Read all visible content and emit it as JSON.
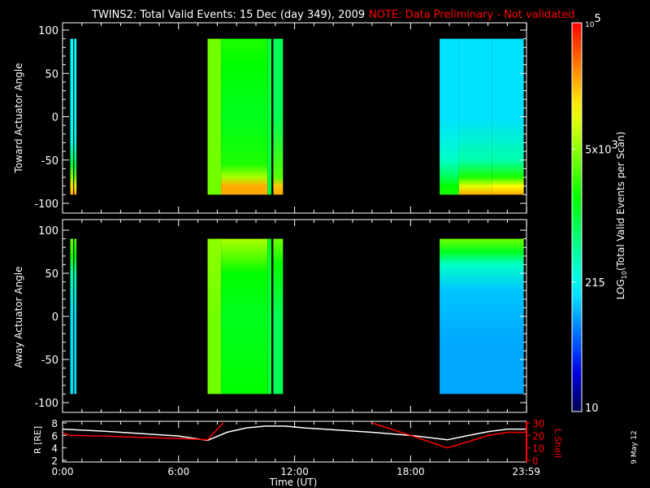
{
  "title": {
    "main": "TWINS2: Total Valid Events: 15 Dec (day 349), 2009",
    "note": "NOTE: Data Preliminary - Not validated"
  },
  "date_stamp": "9 May 12",
  "colors": {
    "note": "#ff0000",
    "axis": "#ffffff",
    "lshell": "#ff0000",
    "radius": "#ffffff"
  },
  "chart_data": [
    {
      "type": "heatmap",
      "ylabel": "Toward Actuator Angle",
      "ylim": [
        -100,
        100
      ],
      "yticks": [
        "100",
        "50",
        "0",
        "-50",
        "-100"
      ],
      "xlim": [
        0,
        24
      ],
      "value_units": "log10 counts",
      "segments": [
        {
          "t": [
            0.4,
            0.55
          ],
          "angles": [
            -90,
            -80,
            -70,
            -55,
            -30,
            0,
            90
          ],
          "values": [
            4.4,
            4.2,
            3.7,
            3.0,
            2.4,
            2.3,
            2.3
          ]
        },
        {
          "t": [
            0.6,
            0.72
          ],
          "angles": [
            -90,
            -80,
            -70,
            -55,
            -30,
            0,
            90
          ],
          "values": [
            4.4,
            4.1,
            3.6,
            2.9,
            2.4,
            2.3,
            2.3
          ]
        },
        {
          "t": [
            7.5,
            8.2
          ],
          "angles": [
            -90,
            -60,
            0,
            60,
            90
          ],
          "values": [
            3.6,
            3.6,
            3.6,
            3.6,
            3.6
          ]
        },
        {
          "t": [
            8.2,
            10.6
          ],
          "angles": [
            -90,
            -80,
            -70,
            -55,
            0,
            60,
            90
          ],
          "values": [
            4.4,
            4.4,
            3.8,
            3.3,
            3.1,
            3.2,
            3.3
          ]
        },
        {
          "t": [
            10.6,
            10.8
          ],
          "angles": [
            -90,
            0,
            90
          ],
          "values": [
            3.0,
            3.0,
            3.0
          ]
        },
        {
          "t": [
            10.9,
            11.4
          ],
          "angles": [
            -90,
            -80,
            -70,
            0,
            90
          ],
          "values": [
            4.4,
            4.3,
            3.5,
            2.9,
            2.9
          ]
        },
        {
          "t": [
            19.5,
            20.5
          ],
          "angles": [
            -90,
            -80,
            -70,
            -50,
            0,
            90
          ],
          "values": [
            3.3,
            3.2,
            2.9,
            2.5,
            2.2,
            2.2
          ]
        },
        {
          "t": [
            20.5,
            22.2
          ],
          "angles": [
            -90,
            -80,
            -70,
            -50,
            0,
            90
          ],
          "values": [
            4.4,
            4.0,
            3.3,
            2.6,
            2.2,
            2.2
          ]
        },
        {
          "t": [
            22.2,
            23.85
          ],
          "angles": [
            -90,
            -80,
            -70,
            -50,
            0,
            90
          ],
          "values": [
            4.4,
            4.1,
            3.3,
            2.6,
            2.2,
            2.2
          ]
        }
      ]
    },
    {
      "type": "heatmap",
      "ylabel": "Away Actuator Angle",
      "ylim": [
        -100,
        100
      ],
      "yticks": [
        "100",
        "50",
        "0",
        "-50",
        "-100"
      ],
      "xlim": [
        0,
        24
      ],
      "value_units": "log10 counts",
      "segments": [
        {
          "t": [
            0.4,
            0.55
          ],
          "angles": [
            -90,
            0,
            50,
            70,
            90
          ],
          "values": [
            2.2,
            2.2,
            2.6,
            3.3,
            3.6
          ]
        },
        {
          "t": [
            0.6,
            0.72
          ],
          "angles": [
            -90,
            0,
            50,
            70,
            90
          ],
          "values": [
            2.2,
            2.2,
            2.6,
            3.2,
            3.5
          ]
        },
        {
          "t": [
            7.5,
            8.2
          ],
          "angles": [
            -90,
            0,
            90
          ],
          "values": [
            3.6,
            3.6,
            3.7
          ]
        },
        {
          "t": [
            8.2,
            10.6
          ],
          "angles": [
            -90,
            0,
            50,
            75,
            90
          ],
          "values": [
            3.2,
            3.1,
            3.2,
            3.6,
            3.8
          ]
        },
        {
          "t": [
            10.6,
            10.8
          ],
          "angles": [
            -90,
            0,
            90
          ],
          "values": [
            3.0,
            3.0,
            3.1
          ]
        },
        {
          "t": [
            10.9,
            11.4
          ],
          "angles": [
            -90,
            0,
            60,
            90
          ],
          "values": [
            2.9,
            2.9,
            3.2,
            3.6
          ]
        },
        {
          "t": [
            19.5,
            23.85
          ],
          "angles": [
            -90,
            -30,
            30,
            60,
            75,
            90
          ],
          "values": [
            2.0,
            2.0,
            2.1,
            2.5,
            3.1,
            3.6
          ]
        }
      ]
    },
    {
      "type": "line",
      "xlabel": "Time (UT)",
      "ylabel": "R [RE]",
      "y2label": "L Shell",
      "xticks": [
        "0:00",
        "6:00",
        "12:00",
        "18:00",
        "23:59"
      ],
      "xtick_values": [
        0,
        6,
        12,
        18,
        23.98
      ],
      "ylim": [
        2,
        8
      ],
      "yticks": [
        "2",
        "4",
        "6",
        "8"
      ],
      "y2lim": [
        0,
        30
      ],
      "y2ticks": [
        "0",
        "10",
        "20",
        "30"
      ],
      "series": [
        {
          "name": "R",
          "axis": "left",
          "x": [
            0,
            2,
            4,
            6,
            7.5,
            8.5,
            9.5,
            10.5,
            11.5,
            12.5,
            14,
            16,
            18,
            19.9,
            21,
            22,
            23,
            24
          ],
          "y": [
            7.0,
            6.7,
            6.3,
            5.9,
            5.2,
            6.5,
            7.2,
            7.5,
            7.5,
            7.2,
            6.9,
            6.5,
            6.0,
            5.3,
            6.0,
            6.6,
            7.0,
            7.0
          ]
        },
        {
          "name": "L Shell",
          "axis": "right",
          "x": [
            0,
            0.4,
            2,
            4,
            6,
            7.5,
            8.3
          ],
          "y": [
            22,
            20,
            19.5,
            18.5,
            17.5,
            16.5,
            30
          ]
        },
        {
          "name": "L Shell (cont.)",
          "axis": "right",
          "x": [
            16,
            18,
            19.9,
            21,
            22,
            23,
            24
          ],
          "y": [
            30,
            20,
            10,
            15,
            20,
            22.5,
            22.5
          ]
        }
      ]
    }
  ],
  "colorbar": {
    "label": "LOG10(Total Valid Events per Scan)",
    "label_main": "LOG",
    "label_sub": "10",
    "label_rest": "(Total Valid Events per Scan)",
    "range": [
      10,
      100000
    ],
    "ticks": [
      {
        "value": 100000,
        "base": "10",
        "exp": "5"
      },
      {
        "value": 5000,
        "base": "5x10",
        "exp": "3"
      },
      {
        "value": 215,
        "base": "215",
        "exp": ""
      },
      {
        "value": 10,
        "base": "10",
        "exp": ""
      }
    ]
  }
}
